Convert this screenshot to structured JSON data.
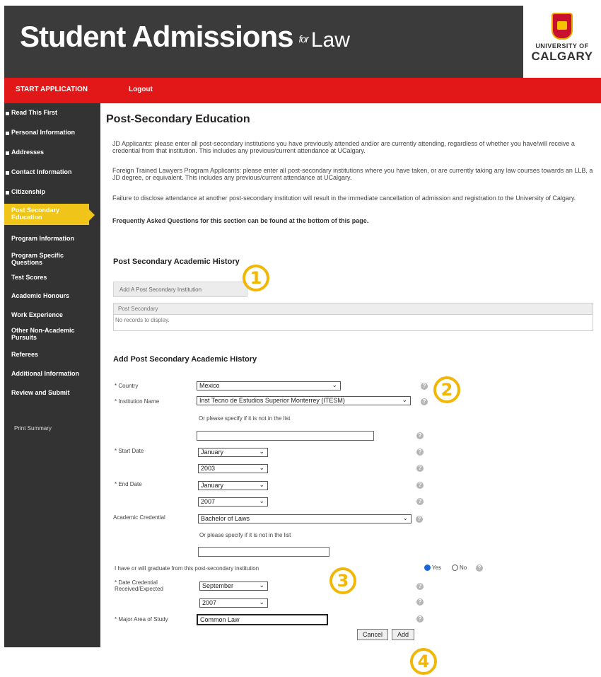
{
  "header": {
    "title": "Student Admissions",
    "for_text": "for",
    "law_text": "Law",
    "university_top": "UNIVERSITY OF",
    "university_name": "CALGARY"
  },
  "topnav": {
    "start_application": "START APPLICATION",
    "logout": "Logout"
  },
  "sidebar": {
    "items": [
      {
        "label": "Read This First"
      },
      {
        "label": "Personal Information"
      },
      {
        "label": "Addresses"
      },
      {
        "label": "Contact Information"
      },
      {
        "label": "Citizenship"
      },
      {
        "label": "Post Secondary Education"
      },
      {
        "label": "Program Information"
      },
      {
        "label": "Program Specific Questions"
      },
      {
        "label": "Test Scores"
      },
      {
        "label": "Academic Honours"
      },
      {
        "label": "Work Experience"
      },
      {
        "label": "Other Non-Academic Pursuits"
      },
      {
        "label": "Referees"
      },
      {
        "label": "Additional Information"
      },
      {
        "label": "Review and Submit"
      }
    ],
    "summary": "Print Summary"
  },
  "page": {
    "title": "Post-Secondary Education",
    "p1": "JD Applicants: please enter all post-secondary institutions you have previously attended and/or are currently attending, regardless of whether you have/will receive a credential from that institution. This includes any previous/current attendance at UCalgary.",
    "p2": "Foreign Trained Lawyers Program Applicants: please enter all post-secondary institutions where you have taken, or are currently taking any law courses towards an LLB, a JD degree, or equivalent. This includes any previous/current attendance at UCalgary.",
    "p3": "Failure to disclose attendance at another post-secondary institution will result in the immediate cancellation of admission and registration to the University of Calgary.",
    "p4": "Frequently Asked Questions for this section can be found at the bottom of this page."
  },
  "history": {
    "section_title": "Post Secondary Academic History",
    "add_button": "Add A Post Secondary Institution",
    "table_header": "Post Secondary",
    "empty_text": "No records to display."
  },
  "form": {
    "section_title": "Add  Post Secondary Academic History",
    "country_label": "* Country",
    "country_value": "Mexico",
    "institution_label": "* Institution Name",
    "institution_value": "Inst Tecno de Estudios Superior Monterrey (ITESM)",
    "specify_label": "Or please specify if it is not in the list",
    "start_label": "* Start Date",
    "start_month": "January",
    "start_year": "2003",
    "end_label": "* End Date",
    "end_month": "January",
    "end_year": "2007",
    "credential_label": "Academic Credential",
    "credential_value": "Bachelor of Laws",
    "graduate_question": "I have or will graduate from this post-secondary institution",
    "yes_label": "Yes",
    "no_label": "No",
    "date_received_label": "* Date Credential Received/Expected",
    "received_month": "September",
    "received_year": "2007",
    "major_label": "* Major Area of Study",
    "major_value": "Common Law",
    "cancel_button": "Cancel",
    "add_button": "Add"
  },
  "callouts": [
    "1",
    "2",
    "3",
    "4"
  ],
  "colors": {
    "header": "#3b3b3b",
    "red_bar": "#e21818",
    "sidebar": "#333333",
    "active": "#f0c419",
    "callout": "#f2b705"
  }
}
